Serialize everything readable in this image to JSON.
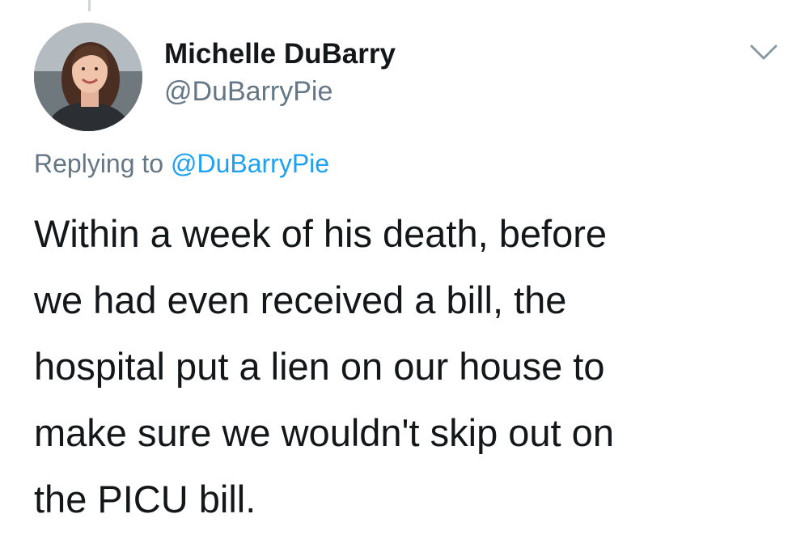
{
  "author": {
    "display_name": "Michelle DuBarry",
    "handle": "@DuBarryPie",
    "avatar_icon": "profile-photo"
  },
  "menu": {
    "icon": "chevron-down-icon"
  },
  "reply": {
    "prefix": "Replying to",
    "mention": "@DuBarryPie"
  },
  "tweet": {
    "lines": [
      "Within a week of his death, before",
      "we had even received a bill, the",
      "hospital put a lien on our house to",
      "make sure we wouldn't skip out on",
      "the PICU bill."
    ]
  },
  "colors": {
    "text": "#14171a",
    "secondary": "#657786",
    "link": "#1da1f2"
  }
}
